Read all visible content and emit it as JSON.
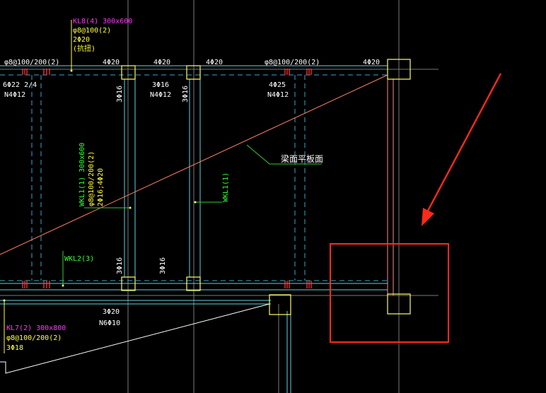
{
  "colors": {
    "background": "#000000",
    "beam_line": "#5fd3e0",
    "beam_dashed": "#34a9c8",
    "column_outline": "#ffff66",
    "text_white": "#ffffff",
    "text_magenta": "#ff33ff",
    "text_yellow": "#ffff33",
    "text_green": "#33ff33",
    "leader_green": "#33cc33",
    "slab_line": "#ff8066",
    "highlight": "#ff2a1a",
    "hatch": "#ff3333",
    "grid": "#8a8a8a"
  },
  "labels": {
    "kl8": {
      "name": "KL8(4) 300x600",
      "stirrup": "φ8@100(2)",
      "top": "2Φ20",
      "extra": "(抗扭)"
    },
    "top_rebar": [
      "φ8@100/200(2)",
      "4Φ20",
      "4Φ20",
      "4Φ20",
      "φ8@100/200(2)",
      "4Φ20"
    ],
    "left_bottom": [
      "6Φ22 2/4",
      "N4Φ12"
    ],
    "mid_bottom": [
      "3Φ16",
      "N4Φ12"
    ],
    "right_bottom": [
      "4Φ25",
      "N4Φ12"
    ],
    "vert_3c16": "3Φ16",
    "slab_label": "梁面平板面",
    "wkl1_left": [
      "WKL1(1) 300x600",
      "φ8@100/200(2)",
      "2Φ16;4Φ20"
    ],
    "wkl1_right": "WKL1(1)",
    "wkl2": "WKL2(3)",
    "bottom_rebar": [
      "3Φ20",
      "N6Φ10"
    ],
    "kl7": {
      "name": "KL7(2) 300x800",
      "stirrup": "φ8@100/200(2)",
      "bottom": "3Φ18"
    }
  }
}
